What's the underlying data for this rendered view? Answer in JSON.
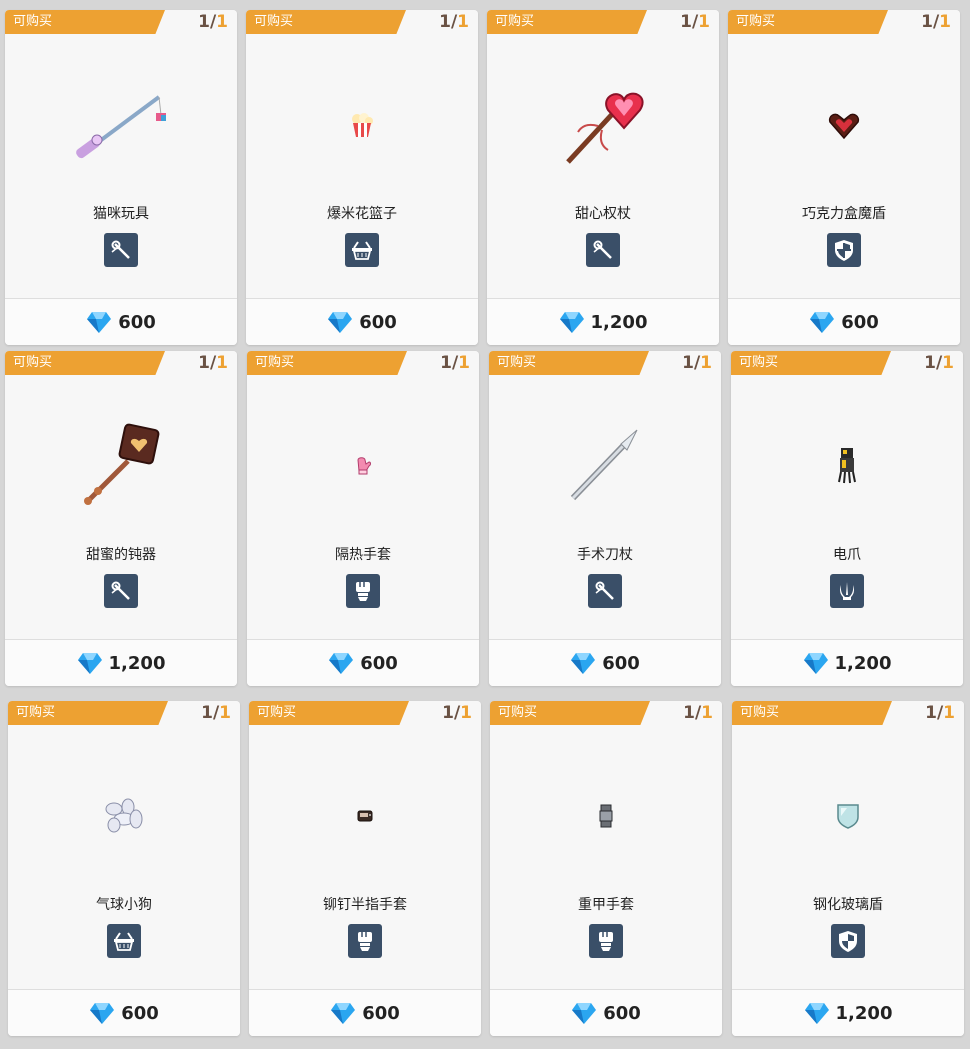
{
  "shop": {
    "items": [
      {
        "tag": "可购买",
        "stock": "1",
        "total": "1",
        "name": "猫咪玩具",
        "type": "staff-icon",
        "price": "600",
        "art": "fishing-rod-icon"
      },
      {
        "tag": "可购买",
        "stock": "1",
        "total": "1",
        "name": "爆米花篮子",
        "type": "basket-icon",
        "price": "600",
        "art": "popcorn-icon"
      },
      {
        "tag": "可购买",
        "stock": "1",
        "total": "1",
        "name": "甜心权杖",
        "type": "staff-icon",
        "price": "1,200",
        "art": "heart-scepter-icon"
      },
      {
        "tag": "可购买",
        "stock": "1",
        "total": "1",
        "name": "巧克力盒魔盾",
        "type": "shield-icon",
        "price": "600",
        "art": "chocolate-box-icon"
      },
      {
        "tag": "可购买",
        "stock": "1",
        "total": "1",
        "name": "甜蜜的钝器",
        "type": "staff-icon",
        "price": "1,200",
        "art": "sweet-mace-icon"
      },
      {
        "tag": "可购买",
        "stock": "1",
        "total": "1",
        "name": "隔热手套",
        "type": "glove-icon",
        "price": "600",
        "art": "oven-mitt-icon"
      },
      {
        "tag": "可购买",
        "stock": "1",
        "total": "1",
        "name": "手术刀杖",
        "type": "staff-icon",
        "price": "600",
        "art": "scalpel-icon"
      },
      {
        "tag": "可购买",
        "stock": "1",
        "total": "1",
        "name": "电爪",
        "type": "claw-icon",
        "price": "1,200",
        "art": "electric-claw-icon"
      },
      {
        "tag": "可购买",
        "stock": "1",
        "total": "1",
        "name": "气球小狗",
        "type": "basket-icon",
        "price": "600",
        "art": "balloon-dog-icon"
      },
      {
        "tag": "可购买",
        "stock": "1",
        "total": "1",
        "name": "铆钉半指手套",
        "type": "glove-icon",
        "price": "600",
        "art": "studded-glove-icon"
      },
      {
        "tag": "可购买",
        "stock": "1",
        "total": "1",
        "name": "重甲手套",
        "type": "glove-icon",
        "price": "600",
        "art": "heavy-gauntlet-icon"
      },
      {
        "tag": "可购买",
        "stock": "1",
        "total": "1",
        "name": "钢化玻璃盾",
        "type": "shield-icon",
        "price": "1,200",
        "art": "glass-shield-icon"
      }
    ],
    "currency_icon": "diamond-icon",
    "colors": {
      "tag": "#eda132",
      "type_icon_bg": "#3a4f68",
      "card_bg": "#f7f7f7",
      "page_bg": "#d6d6d6",
      "stock_total": "#eda132",
      "stock_count": "#6a5244"
    }
  }
}
